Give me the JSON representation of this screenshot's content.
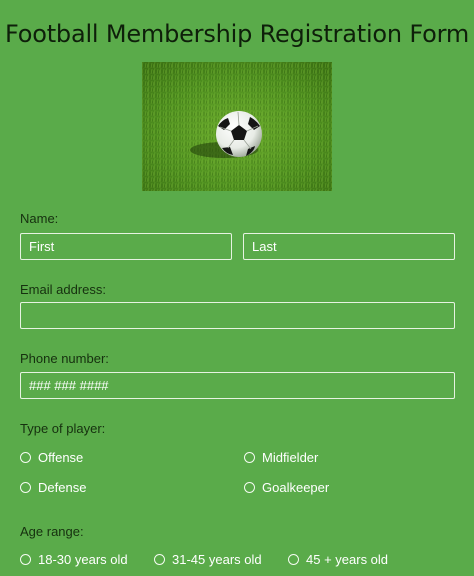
{
  "title": "Football Membership Registration Form",
  "hero_image": "football-on-grass",
  "name": {
    "label": "Name:",
    "first_placeholder": "First",
    "last_placeholder": "Last"
  },
  "email": {
    "label": "Email address:",
    "placeholder": ""
  },
  "phone": {
    "label": "Phone number:",
    "placeholder": "### ### ####"
  },
  "player_type": {
    "label": "Type of player:",
    "options": [
      "Offense",
      "Midfielder",
      "Defense",
      "Goalkeeper"
    ]
  },
  "age_range": {
    "label": "Age range:",
    "options": [
      "18-30 years old",
      "31-45 years old",
      "45 + years old"
    ]
  },
  "colors": {
    "background": "#5aab4a",
    "text_dark": "#16300f",
    "field_border": "#e6f3e1"
  }
}
